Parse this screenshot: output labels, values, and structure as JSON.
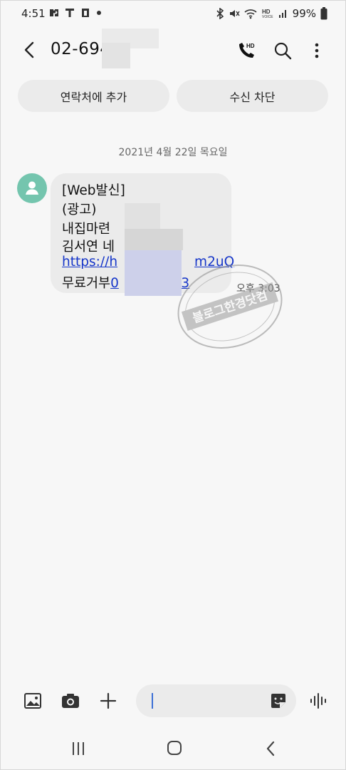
{
  "status_bar": {
    "time": "4:51",
    "battery": "99%",
    "left_icons": [
      "app-notification-icon",
      "tmap-icon",
      "tasks-icon",
      "dot-icon"
    ],
    "right_icons": [
      "bluetooth-icon",
      "mute-icon",
      "wifi-icon",
      "hd-voice-icon",
      "signal-icon",
      "battery-icon"
    ]
  },
  "header": {
    "title": "02-694",
    "buttons": [
      "back-icon",
      "hd-call-icon",
      "search-icon",
      "more-icon"
    ]
  },
  "actions": {
    "add_contact": "연락처에 추가",
    "block": "수신 차단"
  },
  "date_divider": "2021년 4월 22일 목요일",
  "message": {
    "lines": [
      "[Web발신]",
      "(광고)",
      "내집마련 ",
      "김서연 네"
    ],
    "link_prefix": "https://h",
    "link_suffix": "m2uQ",
    "optout_label": "무료거부",
    "optout_number_prefix": "0",
    "optout_number_suffix": "083",
    "time": "오후 3:03"
  },
  "watermark": {
    "text": "블로그한경닷컴"
  },
  "composer": {
    "buttons": [
      "gallery-icon",
      "camera-icon",
      "add-icon",
      "sticker-icon",
      "voice-icon"
    ]
  },
  "nav_bar": {
    "buttons": [
      "recents-icon",
      "home-icon",
      "back-nav-icon"
    ]
  },
  "colors": {
    "background": "#f7f7f7",
    "bubble": "#ebebeb",
    "avatar": "#74c5ae",
    "link": "#1636c9",
    "cursor": "#3b6fd6"
  }
}
